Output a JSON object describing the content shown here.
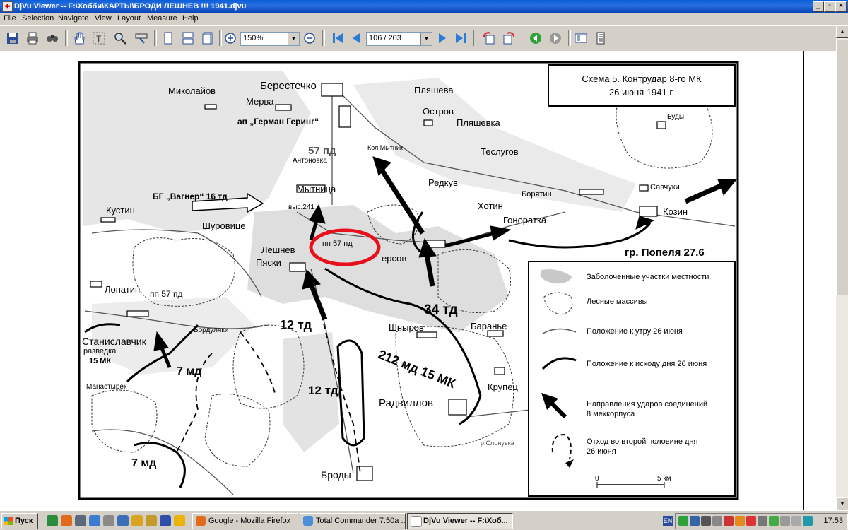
{
  "window": {
    "title": "DjVu Viewer -- F:\\Хобби\\КАРТЫ\\БРОДИ ЛЕШНЕВ !!! 1941.djvu",
    "minimize": "_",
    "maximize": "▫",
    "close": "×"
  },
  "menu": [
    "File",
    "Selection",
    "Navigate",
    "View",
    "Layout",
    "Measure",
    "Help"
  ],
  "toolbar": {
    "zoom_value": "150%",
    "page_value": "106 / 203",
    "icons": [
      "save-icon",
      "print-icon",
      "find-icon",
      "hand-tool-icon",
      "text-select-icon",
      "zoom-tool-icon",
      "ruler-tool-icon",
      "single-page-icon",
      "continuous-icon",
      "facing-pages-icon",
      "zoom-in-icon",
      "zoom-out-icon",
      "first-page-icon",
      "prev-page-icon",
      "next-page-icon",
      "last-page-icon",
      "rotate-left-icon",
      "rotate-right-icon",
      "back-icon",
      "forward-icon",
      "thumbnails-icon",
      "bookmarks-icon"
    ]
  },
  "map": {
    "scheme_title_line1": "Схема 5. Контрудар 8-го МК",
    "scheme_title_line2": "26 июня 1941 г.",
    "places": {
      "berestechko": "Берестечко",
      "mykolaiv": "Миколайов",
      "merva": "Мерва",
      "plyasheva": "Пляшева",
      "ostrov": "Остров",
      "plyashevka": "Пляшевка",
      "budy": "Буды",
      "kol_mytnik": "Кол.Мытник",
      "teslugov": "Теслугов",
      "redkuv": "Редкув",
      "boryatin": "Борятин",
      "savchuki": "Савчуки",
      "khotin": "Хотин",
      "antonovka": "Антоновка",
      "mytnitsa": "Мытница",
      "kustin": "Кустин",
      "vys241": "выс.241",
      "shurovitse": "Шуровице",
      "gonoratka": "Гоноратка",
      "kozin": "Козин",
      "leshnev": "Лешнев",
      "pyaski": "Пяски",
      "ersov": "ерсов",
      "lopatin": "Лопатин",
      "shnyrov": "Шныров",
      "baranye": "Баранье",
      "stanislavchik": "Станиславчик",
      "bordulyaki": "Бордуляки",
      "manastyrek": "Манастырек",
      "krupets": "Крупец",
      "radvillov": "Радвиллов",
      "brody": "Броды",
      "r_slonuvka": "р.Слонувка"
    },
    "units": {
      "ap_goering": "ап „Герман Геринг“",
      "d57": "57 пд",
      "bg_wagner": "БГ „Вагнер“ 16 тд",
      "pp57_circled": "пп 57 пд",
      "pp57_lopatin": "пп 57 пд",
      "gr_popel": "гр. Попеля 27.6",
      "td34": "34 тд",
      "td12_a": "12 тд",
      "td12_b": "12 тд",
      "md212": "212 мд 15 МК",
      "md7_a": "7 мд",
      "md7_b": "7 мд",
      "razvedka1": "разведка",
      "razvedka2": "15 МК"
    },
    "legend": {
      "swamp": "Заболоченные участки местности",
      "forest": "Лесные массивы",
      "morning": "Положение к утру 26 июня",
      "evening": "Положение к исходу дня 26 июня",
      "attack1": "Направления ударов соединений",
      "attack2": "8 мехкорпуса",
      "retreat1": "Отход во второй половине дня",
      "retreat2": "26 июня",
      "scale0": "0",
      "scale5": "5 км"
    }
  },
  "taskbar": {
    "start": "Пуск",
    "tasks": [
      "Google - Mozilla Firefox",
      "Total Commander 7.50a ...",
      "DjVu Viewer -- F:\\Хоб..."
    ],
    "language": "EN",
    "clock": "17:53"
  }
}
